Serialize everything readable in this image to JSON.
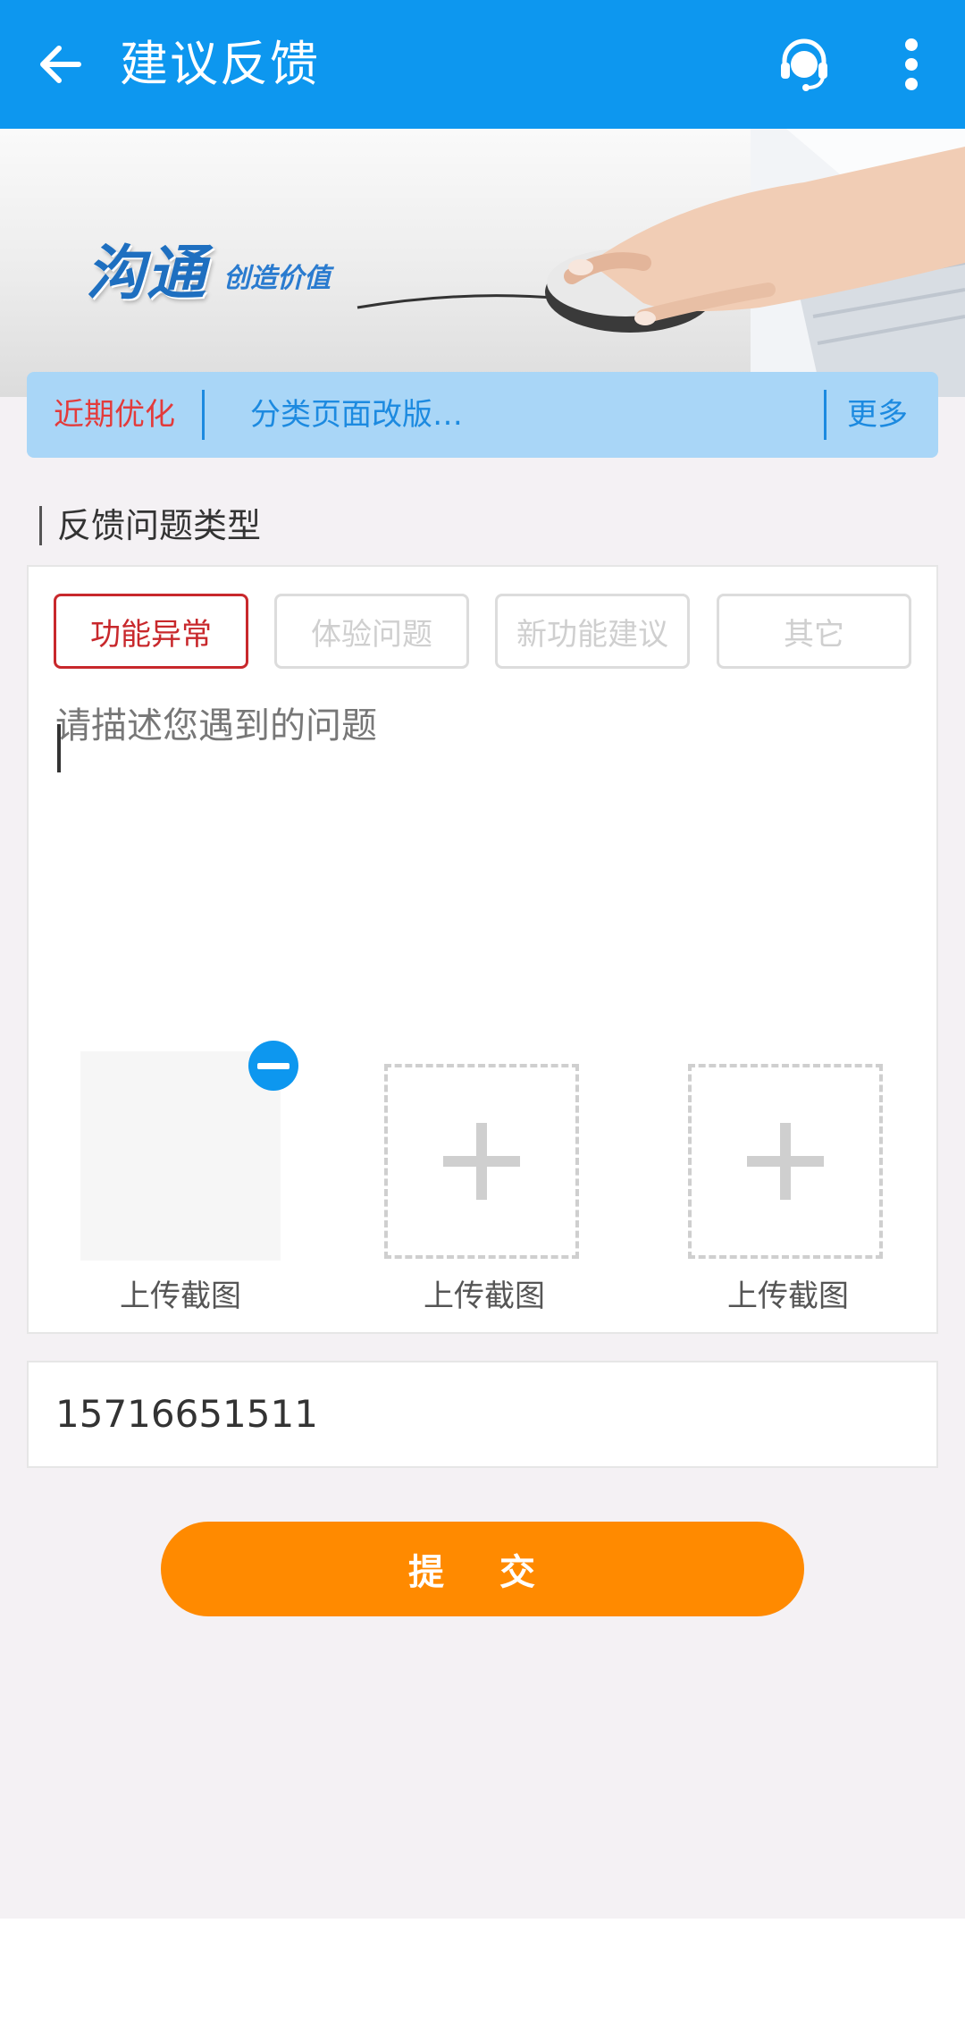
{
  "appbar": {
    "title": "建议反馈",
    "back_icon": "arrow-left-icon",
    "support_icon": "headset-icon",
    "more_icon": "more-vert-icon",
    "color": "#0d97ef"
  },
  "banner": {
    "logo_text": "沟通",
    "slogan": "创造价值"
  },
  "notice": {
    "tag": "近期优化",
    "text": "分类页面改版…",
    "more": "更多"
  },
  "feedback": {
    "section_title": "反馈问题类型",
    "types": [
      {
        "label": "功能异常",
        "selected": true
      },
      {
        "label": "体验问题",
        "selected": false
      },
      {
        "label": "新功能建议",
        "selected": false
      },
      {
        "label": "其它",
        "selected": false
      }
    ],
    "description_placeholder": "请描述您遇到的问题",
    "uploads": [
      {
        "label": "上传截图",
        "state": "filled"
      },
      {
        "label": "上传截图",
        "state": "empty"
      },
      {
        "label": "上传截图",
        "state": "empty"
      }
    ]
  },
  "contact": {
    "phone": "15716651511"
  },
  "submit_label": "提 交",
  "colors": {
    "accent": "#0d97ef",
    "selected": "#c8282c",
    "submit": "#ff8a00",
    "notice_tag": "#e33b3b"
  }
}
